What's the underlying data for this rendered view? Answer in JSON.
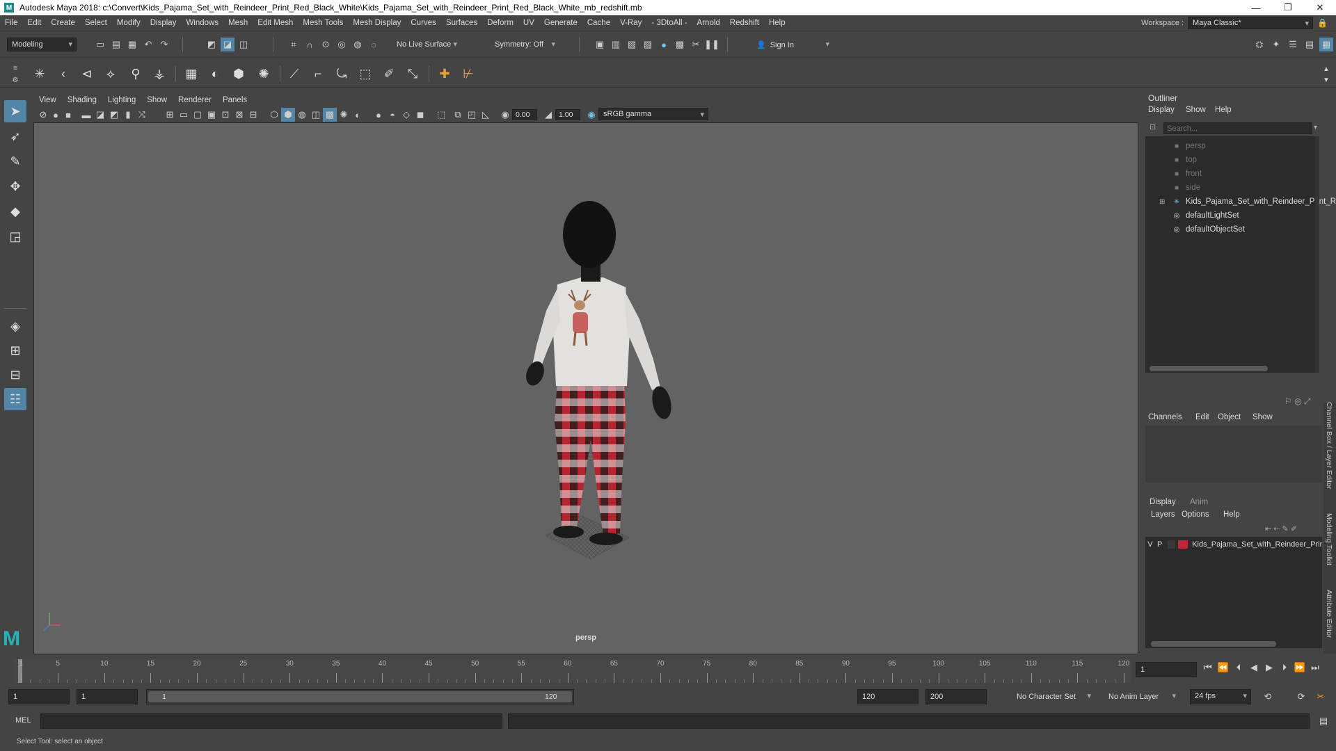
{
  "titlebar": {
    "title": "Autodesk Maya 2018: c:\\Convert\\Kids_Pajama_Set_with_Reindeer_Print_Red_Black_White\\Kids_Pajama_Set_with_Reindeer_Print_Red_Black_White_mb_redshift.mb",
    "minimize": "—",
    "restore": "❐",
    "close": "✕"
  },
  "menubar": {
    "items": [
      "File",
      "Edit",
      "Create",
      "Select",
      "Modify",
      "Display",
      "Windows",
      "Mesh",
      "Edit Mesh",
      "Mesh Tools",
      "Mesh Display",
      "Curves",
      "Surfaces",
      "Deform",
      "UV",
      "Generate",
      "Cache",
      "V-Ray",
      "- 3DtoAll -",
      "Arnold",
      "Redshift",
      "Help"
    ],
    "workspace_label": "Workspace :",
    "workspace_value": "Maya Classic*"
  },
  "statusline": {
    "mode": "Modeling",
    "live_surface": "No Live Surface",
    "symmetry": "Symmetry: Off",
    "sign_in": "Sign In"
  },
  "viewport": {
    "menus": [
      "View",
      "Shading",
      "Lighting",
      "Show",
      "Renderer",
      "Panels"
    ],
    "exposure": "0.00",
    "gamma": "1.00",
    "color_space": "sRGB gamma",
    "camera_label": "persp"
  },
  "outliner": {
    "title": "Outliner",
    "menus": [
      "Display",
      "Show",
      "Help"
    ],
    "search_placeholder": "Search...",
    "items": [
      {
        "label": "persp",
        "type": "camera",
        "dim": true
      },
      {
        "label": "top",
        "type": "camera",
        "dim": true
      },
      {
        "label": "front",
        "type": "camera",
        "dim": true
      },
      {
        "label": "side",
        "type": "camera",
        "dim": true
      },
      {
        "label": "Kids_Pajama_Set_with_Reindeer_Print_Re",
        "type": "group",
        "dim": false
      },
      {
        "label": "defaultLightSet",
        "type": "set",
        "dim": false
      },
      {
        "label": "defaultObjectSet",
        "type": "set",
        "dim": false
      }
    ]
  },
  "channelbox": {
    "menus": [
      "Channels",
      "Edit",
      "Object",
      "Show"
    ],
    "tabs": [
      "Display",
      "Anim"
    ],
    "layer_menus": [
      "Layers",
      "Options",
      "Help"
    ],
    "layer": {
      "v": "V",
      "p": "P",
      "name": "Kids_Pajama_Set_with_Reindeer_Prin",
      "color": "#c0263a"
    }
  },
  "sidetabs": [
    "Channel Box / Layer Editor",
    "Modeling Toolkit",
    "Attribute Editor"
  ],
  "timeslider": {
    "ticks": [
      "1",
      "5",
      "10",
      "15",
      "20",
      "25",
      "30",
      "35",
      "40",
      "45",
      "50",
      "55",
      "60",
      "65",
      "70",
      "75",
      "80",
      "85",
      "90",
      "95",
      "100",
      "105",
      "110",
      "115",
      "120"
    ],
    "current_frame": "1"
  },
  "rangeslider": {
    "start": "1",
    "playback_start": "1",
    "range_start": "1",
    "range_end": "120",
    "playback_end": "120",
    "end": "200",
    "character_set": "No Character Set",
    "anim_layer": "No Anim Layer",
    "fps": "24 fps"
  },
  "cmdline": {
    "label": "MEL"
  },
  "helpline": {
    "text": "Select Tool: select an object"
  }
}
